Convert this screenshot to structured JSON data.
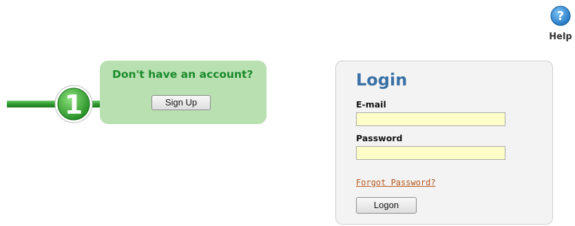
{
  "help": {
    "label": "Help",
    "glyph": "?",
    "icon": "help-circle-icon",
    "color": "#2e8fd8"
  },
  "signup_callout": {
    "title": "Don't have an account?",
    "button_label": "Sign Up",
    "step_number": "1",
    "background": "#b8e0b0",
    "title_color": "#1a8a2b",
    "arrow_color": "#3aa63a"
  },
  "login": {
    "title": "Login",
    "title_color": "#3a70a6",
    "email_label": "E-mail",
    "email_value": "",
    "password_label": "Password",
    "password_value": "",
    "forgot_label": "Forgot Password?",
    "logon_label": "Logon",
    "input_background": "#fefec8",
    "link_color": "#b5541a"
  }
}
